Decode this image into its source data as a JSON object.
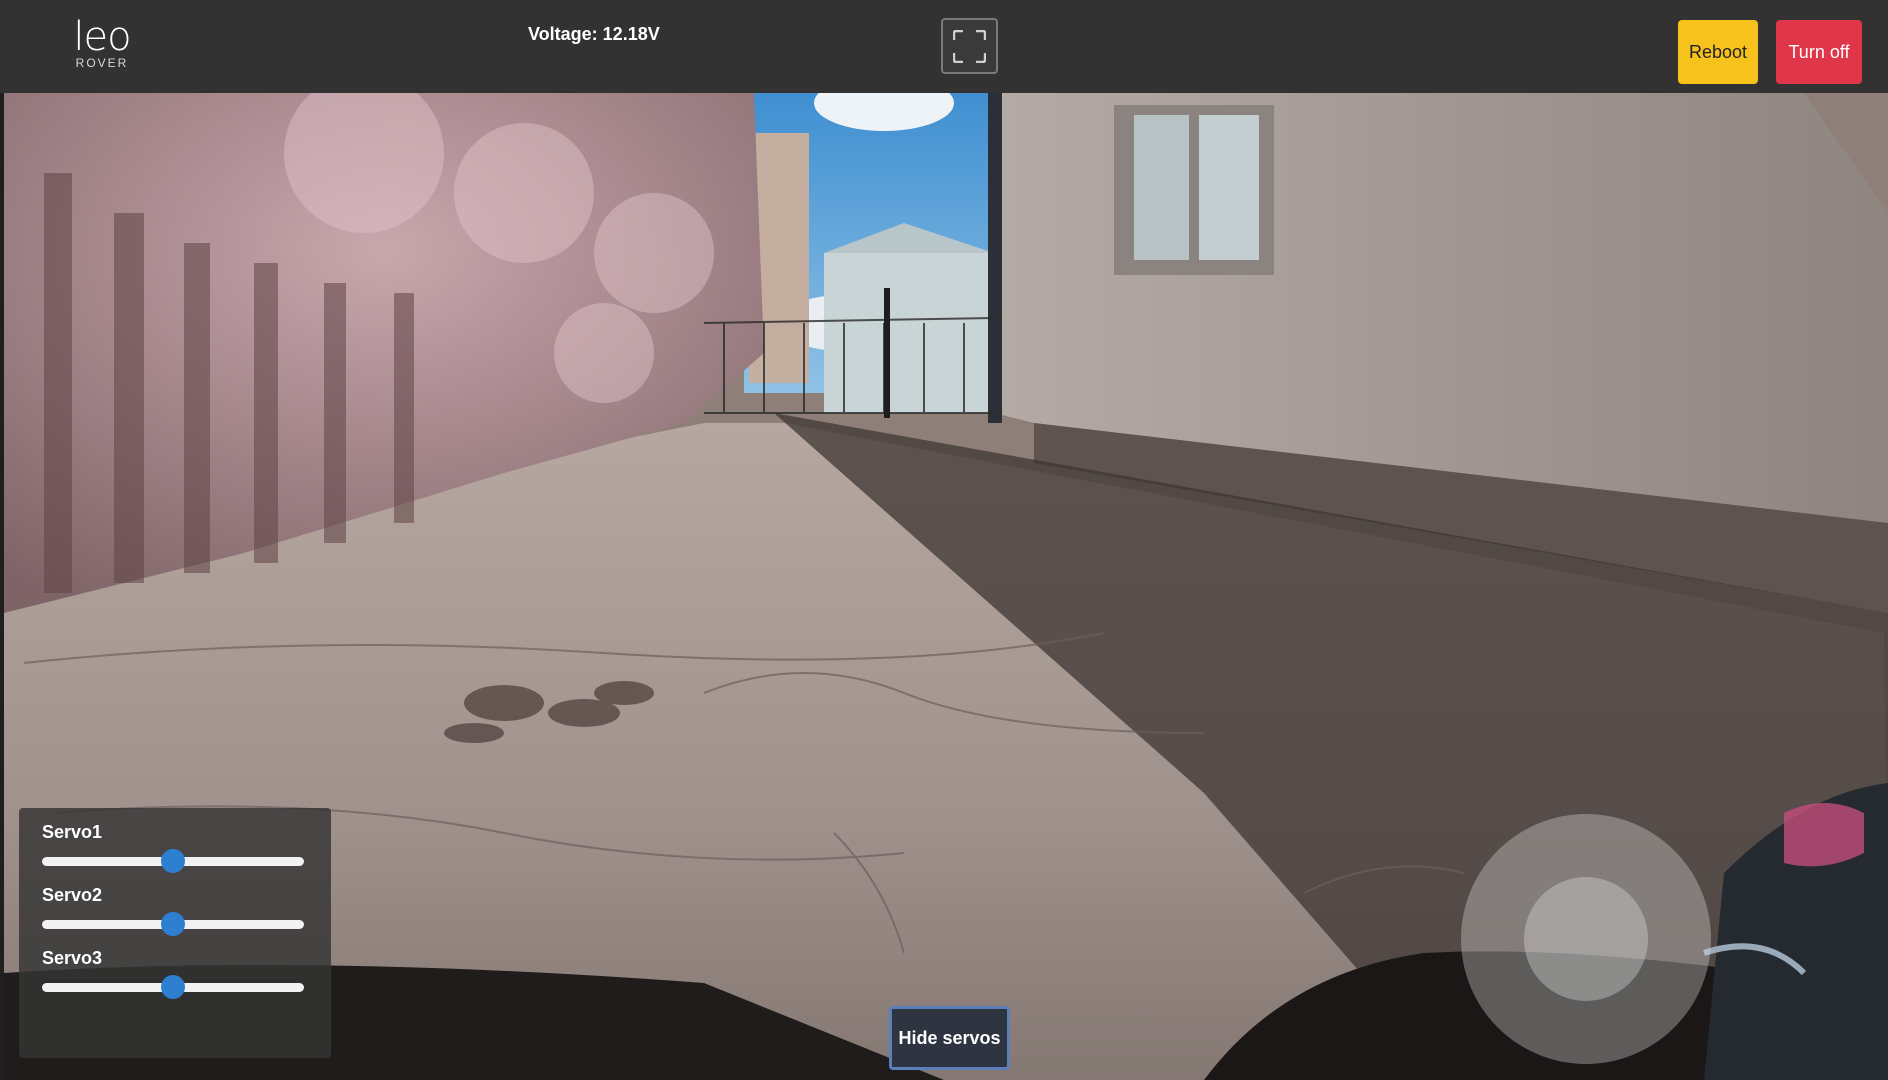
{
  "header": {
    "logo_text": "leo",
    "logo_subtext": "ROVER",
    "voltage_label": "Voltage: 12.18V",
    "fullscreen_icon": "fullscreen-icon",
    "reboot_label": "Reboot",
    "turn_off_label": "Turn off"
  },
  "servos": [
    {
      "label": "Servo1",
      "value": 0.5
    },
    {
      "label": "Servo2",
      "value": 0.5
    },
    {
      "label": "Servo3",
      "value": 0.5
    }
  ],
  "hide_servos_label": "Hide servos",
  "joystick": {
    "x": 0.0,
    "y": 0.0
  },
  "colors": {
    "topbar": "#323232",
    "reboot": "#f6c21b",
    "turn_off": "#e0364a",
    "slider_thumb": "#2f7fd1"
  }
}
